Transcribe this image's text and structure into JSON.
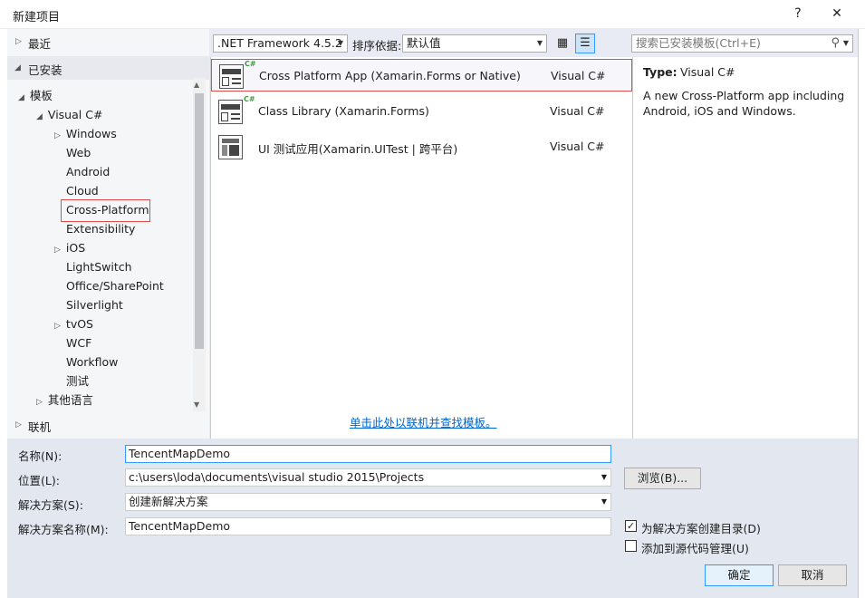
{
  "window": {
    "title": "新建项目",
    "help": "?",
    "close": "✕"
  },
  "left": {
    "recent": "最近",
    "installed": "已安装",
    "templates": "模板",
    "visual_csharp": "Visual C#",
    "items": [
      "Windows",
      "Web",
      "Android",
      "Cloud",
      "Cross-Platform",
      "Extensibility",
      "iOS",
      "LightSwitch",
      "Office/SharePoint",
      "Silverlight",
      "tvOS",
      "WCF",
      "Workflow",
      "测试"
    ],
    "other_languages": "其他语言",
    "online": "联机"
  },
  "toolbar": {
    "framework": ".NET Framework 4.5.2",
    "sort_label": "排序依据:",
    "sort_value": "默认值",
    "search_placeholder": "搜索已安装模板(Ctrl+E)"
  },
  "templates": [
    {
      "name": "Cross Platform App (Xamarin.Forms or Native)",
      "lang": "Visual C#",
      "icon": "cross-platform-app-icon"
    },
    {
      "name": "Class Library (Xamarin.Forms)",
      "lang": "Visual C#",
      "icon": "class-library-icon"
    },
    {
      "name": "UI 测试应用(Xamarin.UITest | 跨平台)",
      "lang": "Visual C#",
      "icon": "ui-test-icon"
    }
  ],
  "online_link": "单击此处以联机并查找模板。",
  "details": {
    "type_label": "Type:",
    "type_value": "Visual C#",
    "description": "A new Cross-Platform app including Android, iOS and Windows."
  },
  "form": {
    "name_label": "名称(N):",
    "name_value": "TencentMapDemo",
    "location_label": "位置(L):",
    "location_value": "c:\\users\\loda\\documents\\visual studio 2015\\Projects",
    "browse": "浏览(B)...",
    "solution_label": "解决方案(S):",
    "solution_value": "创建新解决方案",
    "solution_name_label": "解决方案名称(M):",
    "solution_name_value": "TencentMapDemo",
    "create_dir": "为解决方案创建目录(D)",
    "add_source_control": "添加到源代码管理(U)",
    "ok": "确定",
    "cancel": "取消"
  },
  "colors": {
    "accent": "#0066cc",
    "selection_border": "#e04b4b",
    "background": "#e8ebf3"
  }
}
